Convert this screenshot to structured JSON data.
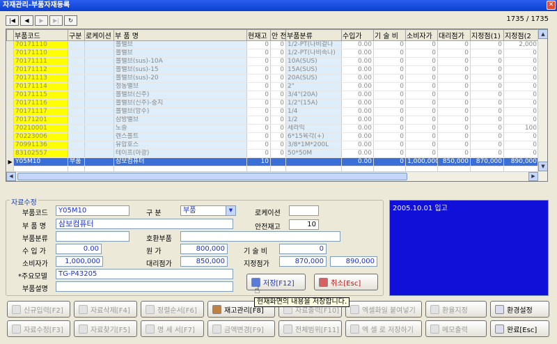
{
  "window": {
    "title": "자재관리-부품자재등록",
    "close": "✕"
  },
  "nav": {
    "first": "|◀",
    "prev": "◀",
    "next": "▶",
    "last": "▶|",
    "refresh": "↻",
    "counter": "1735 / 1735"
  },
  "grid": {
    "headers": [
      "부품코드",
      "구분",
      "로케이션",
      "부 품 명",
      "현재고",
      "안 전",
      "부품분류",
      "수입가",
      "기 술 비",
      "소비자가",
      "대리점가",
      "지정점(1)",
      "지정점(2"
    ],
    "rows": [
      [
        "70171110",
        "",
        "",
        "볼밸브",
        "0",
        "0",
        "1/2-PT(나비겉나",
        "0.00",
        "0",
        "0",
        "0",
        "0",
        "2,000"
      ],
      [
        "70171110",
        "",
        "",
        "볼밸브",
        "0",
        "0",
        "1/2-PT(나비속나)",
        "0.00",
        "0",
        "0",
        "0",
        "0",
        "0"
      ],
      [
        "70171111",
        "",
        "",
        "볼밸브(sus)-10A",
        "0",
        "0",
        "10A(SUS)",
        "0.00",
        "0",
        "0",
        "0",
        "0",
        "0"
      ],
      [
        "70171112",
        "",
        "",
        "볼밸브(sus)-15",
        "0",
        "0",
        "15A(SUS)",
        "0.00",
        "0",
        "0",
        "0",
        "0",
        "0"
      ],
      [
        "70171113",
        "",
        "",
        "볼밸브(sus)-20",
        "0",
        "0",
        "20A(SUS)",
        "0.00",
        "0",
        "0",
        "0",
        "0",
        "0"
      ],
      [
        "70171114",
        "",
        "",
        "정동밸브",
        "0",
        "0",
        "2\"",
        "0.00",
        "0",
        "0",
        "0",
        "0",
        "0"
      ],
      [
        "70171115",
        "",
        "",
        "볼밸브(신주)",
        "0",
        "0",
        "3/4\"(20A)",
        "0.00",
        "0",
        "0",
        "0",
        "0",
        "0"
      ],
      [
        "70171116",
        "",
        "",
        "볼밸브(신주)-중지",
        "0",
        "0",
        "1/2\"(15A)",
        "0.00",
        "0",
        "0",
        "0",
        "0",
        "0"
      ],
      [
        "70171117",
        "",
        "",
        "볼밸브(앙수)",
        "0",
        "0",
        "1/4",
        "0.00",
        "0",
        "0",
        "0",
        "0",
        "0"
      ],
      [
        "70171201",
        "",
        "",
        "삼방밸브",
        "0",
        "0",
        "1/2",
        "0.00",
        "0",
        "0",
        "0",
        "0",
        "0"
      ],
      [
        "70210001",
        "",
        "",
        "노즐",
        "0",
        "0",
        "세라믹",
        "0.00",
        "0",
        "0",
        "0",
        "0",
        "100"
      ],
      [
        "70223006",
        "",
        "",
        "렌스볼트",
        "0",
        "0",
        "6*15육각(+)",
        "0.00",
        "0",
        "0",
        "0",
        "0",
        "0"
      ],
      [
        "70991136",
        "",
        "",
        "유압호스",
        "0",
        "0",
        "3/8*1M*200L",
        "0.00",
        "0",
        "0",
        "0",
        "0",
        "0"
      ],
      [
        "83102557",
        "",
        "",
        "테이프(아광)",
        "0",
        "0",
        "50*50M",
        "0.00",
        "0",
        "0",
        "0",
        "0",
        "0"
      ],
      [
        "Y05M10",
        "부품",
        "",
        "삼보컴퓨터",
        "10",
        "",
        "",
        "0.00",
        "0",
        "1,000,000",
        "850,000",
        "870,000",
        "890,000"
      ]
    ],
    "selected_marker": "▶",
    "scroll": {
      "up": "▲",
      "down": "▼",
      "left": "◀",
      "right": "▶"
    }
  },
  "form": {
    "group_title": "자료수정",
    "labels": {
      "code": "부품코드",
      "category": "구     분",
      "location": "로케이션",
      "name": "부 품 명",
      "safety": "안전재고",
      "class": "부품분류",
      "compat": "호환부품",
      "import": "수 입 가",
      "cost": "원     가",
      "tech": "기 술 비",
      "consumer": "소비자가",
      "agency": "대리점가",
      "designated": "지정점가",
      "model": "*주요모델",
      "desc": "부품설명"
    },
    "values": {
      "code": "Y05M10",
      "category": "부품",
      "location": "",
      "name": "삼보컴퓨터",
      "safety": "10",
      "class": "",
      "compat": "",
      "import": "0.00",
      "cost": "800,000",
      "tech": "0",
      "consumer": "1,000,000",
      "agency": "850,000",
      "designated1": "870,000",
      "designated2": "890,000",
      "model": "TG-P43205",
      "desc": ""
    },
    "save": "저장[F12]",
    "cancel": "취소[Esc]"
  },
  "memo": "2005.10.01 입고",
  "buttons": {
    "row1": [
      "신규입력[F2]",
      "자료삭제[F4]",
      "정렬순서[F6]",
      "재고관리[F8]",
      "자료출력[F10]",
      "엑셀화일 붙여넣기",
      "환율지정",
      "환경설정"
    ],
    "row2": [
      "자료수정[F3]",
      "자료찾기[F5]",
      "명 세 서[F7]",
      "금액변경[F9]",
      "전체범위[F11]",
      "엑 셀 로 저장하기",
      "메모출력",
      "완료[Esc]"
    ]
  },
  "tooltip": "현재화면의 내용을 저장합니다."
}
